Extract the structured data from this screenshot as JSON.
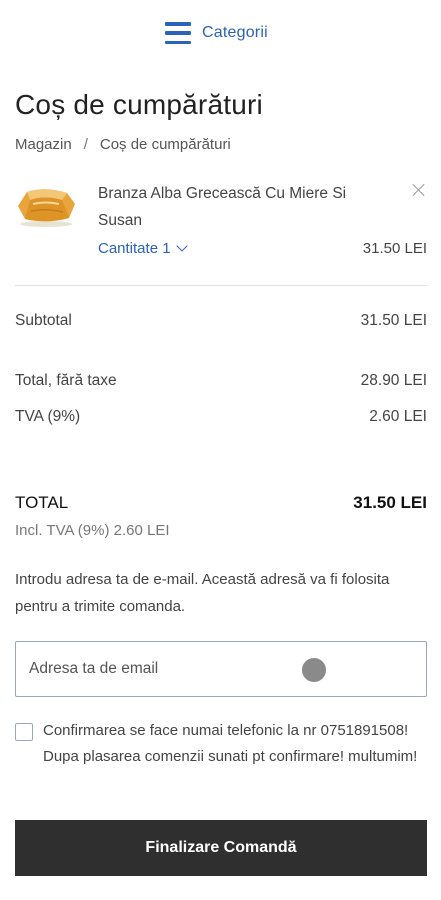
{
  "header": {
    "categories_label": "Categorii",
    "accent_color": "#2a63b8"
  },
  "page": {
    "title": "Coș de cumpărături"
  },
  "breadcrumb": {
    "items": [
      "Magazin",
      "Coș de cumpărături"
    ],
    "separator": "/"
  },
  "cart": {
    "items": [
      {
        "name": "Branza Alba Grecească Cu Miere Si Susan",
        "quantity_label": "Cantitate 1",
        "price": "31.50 LEI"
      }
    ]
  },
  "summary": {
    "subtotal_label": "Subtotal",
    "subtotal_value": "31.50 LEI",
    "net_label": "Total, fără taxe",
    "net_value": "28.90 LEI",
    "vat_label": "TVA (9%)",
    "vat_value": "2.60 LEI",
    "total_label": "TOTAL",
    "total_value": "31.50 LEI",
    "incl_vat": "Incl. TVA (9%) 2.60 LEI"
  },
  "email": {
    "info": "Introdu adresa ta de e-mail. Această adresă va fi folosita pentru a trimite comanda.",
    "placeholder": "Adresa ta de email"
  },
  "consent": {
    "text": "Confirmarea se face numai telefonic la nr 0751891508! Dupa plasarea comenzii sunati pt confirmare! multumim!"
  },
  "checkout": {
    "button_label": "Finalizare Comandă",
    "button_color": "#2f2f2f"
  }
}
